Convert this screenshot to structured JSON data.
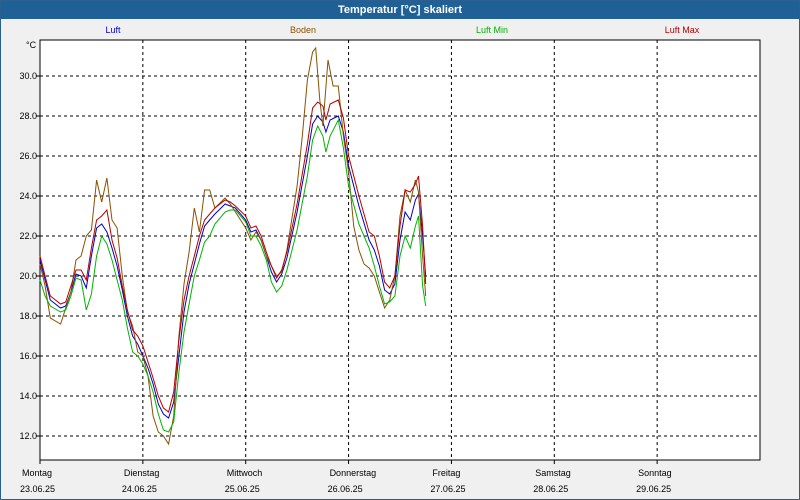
{
  "window": {
    "title": "Temperatur [°C] skaliert"
  },
  "chart_data": {
    "type": "line",
    "title": "Temperatur [°C] skaliert",
    "ylabel": "°C",
    "xlabel": "",
    "ylim": [
      10.8,
      31.8
    ],
    "yticks": [
      "12.0",
      "14.0",
      "16.0",
      "18.0",
      "20.0",
      "22.0",
      "24.0",
      "26.0",
      "28.0",
      "30.0"
    ],
    "xlim": [
      0,
      7
    ],
    "x_days": [
      {
        "weekday": "Montag",
        "date": "23.06.25"
      },
      {
        "weekday": "Dienstag",
        "date": "24.06.25"
      },
      {
        "weekday": "Mittwoch",
        "date": "25.06.25"
      },
      {
        "weekday": "Donnerstag",
        "date": "26.06.25"
      },
      {
        "weekday": "Freitag",
        "date": "27.06.25"
      },
      {
        "weekday": "Samstag",
        "date": "28.06.25"
      },
      {
        "weekday": "Sonntag",
        "date": "29.06.25"
      }
    ],
    "grid": true,
    "legend_position": "top",
    "series": [
      {
        "name": "Luft",
        "color": "#0000c8",
        "points": [
          [
            0.0,
            20.8
          ],
          [
            0.05,
            19.8
          ],
          [
            0.1,
            18.8
          ],
          [
            0.2,
            18.4
          ],
          [
            0.25,
            18.5
          ],
          [
            0.3,
            19.2
          ],
          [
            0.35,
            20.1
          ],
          [
            0.4,
            20.0
          ],
          [
            0.45,
            19.4
          ],
          [
            0.5,
            21.0
          ],
          [
            0.55,
            22.4
          ],
          [
            0.6,
            22.6
          ],
          [
            0.65,
            22.2
          ],
          [
            0.7,
            21.4
          ],
          [
            0.75,
            20.5
          ],
          [
            0.8,
            19.3
          ],
          [
            0.85,
            18.0
          ],
          [
            0.9,
            17.0
          ],
          [
            0.95,
            16.6
          ],
          [
            1.0,
            16.0
          ],
          [
            1.05,
            15.4
          ],
          [
            1.1,
            14.6
          ],
          [
            1.15,
            13.6
          ],
          [
            1.2,
            13.1
          ],
          [
            1.25,
            12.9
          ],
          [
            1.3,
            13.7
          ],
          [
            1.35,
            16.0
          ],
          [
            1.4,
            18.2
          ],
          [
            1.45,
            19.6
          ],
          [
            1.5,
            20.6
          ],
          [
            1.55,
            21.6
          ],
          [
            1.6,
            22.5
          ],
          [
            1.65,
            22.8
          ],
          [
            1.7,
            23.1
          ],
          [
            1.8,
            23.6
          ],
          [
            1.85,
            23.5
          ],
          [
            1.9,
            23.4
          ],
          [
            2.0,
            22.8
          ],
          [
            2.05,
            22.2
          ],
          [
            2.1,
            22.3
          ],
          [
            2.15,
            21.8
          ],
          [
            2.2,
            21.0
          ],
          [
            2.25,
            20.2
          ],
          [
            2.3,
            19.7
          ],
          [
            2.35,
            20.1
          ],
          [
            2.4,
            20.9
          ],
          [
            2.5,
            23.2
          ],
          [
            2.6,
            26.0
          ],
          [
            2.65,
            27.6
          ],
          [
            2.7,
            28.0
          ],
          [
            2.75,
            27.7
          ],
          [
            2.78,
            27.2
          ],
          [
            2.82,
            27.8
          ],
          [
            2.9,
            28.0
          ],
          [
            2.95,
            27.2
          ],
          [
            3.0,
            25.5
          ],
          [
            3.1,
            23.5
          ],
          [
            3.2,
            21.8
          ],
          [
            3.25,
            21.3
          ],
          [
            3.3,
            20.5
          ],
          [
            3.35,
            19.3
          ],
          [
            3.4,
            19.1
          ],
          [
            3.45,
            19.6
          ],
          [
            3.5,
            21.8
          ],
          [
            3.55,
            23.2
          ],
          [
            3.6,
            22.8
          ],
          [
            3.65,
            23.8
          ],
          [
            3.68,
            24.1
          ],
          [
            3.72,
            22.0
          ],
          [
            3.75,
            20.0
          ]
        ]
      },
      {
        "name": "Boden",
        "color": "#8c5000",
        "points": [
          [
            0.0,
            20.6
          ],
          [
            0.05,
            19.5
          ],
          [
            0.1,
            17.9
          ],
          [
            0.2,
            17.6
          ],
          [
            0.3,
            19.2
          ],
          [
            0.35,
            20.8
          ],
          [
            0.4,
            21.0
          ],
          [
            0.45,
            22.0
          ],
          [
            0.5,
            22.3
          ],
          [
            0.55,
            24.8
          ],
          [
            0.6,
            23.7
          ],
          [
            0.65,
            24.9
          ],
          [
            0.7,
            22.8
          ],
          [
            0.75,
            22.4
          ],
          [
            0.8,
            20.0
          ],
          [
            0.85,
            18.2
          ],
          [
            0.9,
            17.5
          ],
          [
            0.95,
            16.2
          ],
          [
            1.0,
            16.0
          ],
          [
            1.05,
            15.0
          ],
          [
            1.1,
            13.0
          ],
          [
            1.15,
            12.2
          ],
          [
            1.2,
            12.0
          ],
          [
            1.25,
            11.6
          ],
          [
            1.3,
            13.0
          ],
          [
            1.35,
            17.0
          ],
          [
            1.4,
            19.6
          ],
          [
            1.45,
            21.2
          ],
          [
            1.5,
            23.4
          ],
          [
            1.55,
            22.2
          ],
          [
            1.6,
            24.3
          ],
          [
            1.65,
            24.3
          ],
          [
            1.7,
            23.4
          ],
          [
            1.8,
            23.9
          ],
          [
            1.85,
            23.6
          ],
          [
            1.9,
            23.2
          ],
          [
            2.0,
            22.4
          ],
          [
            2.05,
            21.8
          ],
          [
            2.1,
            22.2
          ],
          [
            2.15,
            21.8
          ],
          [
            2.2,
            21.0
          ],
          [
            2.25,
            20.5
          ],
          [
            2.3,
            20.0
          ],
          [
            2.35,
            20.2
          ],
          [
            2.4,
            21.3
          ],
          [
            2.5,
            24.5
          ],
          [
            2.55,
            27.0
          ],
          [
            2.6,
            29.8
          ],
          [
            2.65,
            31.2
          ],
          [
            2.68,
            31.4
          ],
          [
            2.72,
            28.8
          ],
          [
            2.75,
            27.5
          ],
          [
            2.8,
            30.8
          ],
          [
            2.85,
            29.5
          ],
          [
            2.9,
            29.5
          ],
          [
            2.95,
            27.0
          ],
          [
            3.0,
            25.2
          ],
          [
            3.05,
            22.5
          ],
          [
            3.1,
            21.3
          ],
          [
            3.15,
            20.6
          ],
          [
            3.2,
            20.4
          ],
          [
            3.25,
            20.0
          ],
          [
            3.3,
            19.2
          ],
          [
            3.35,
            18.4
          ],
          [
            3.4,
            18.8
          ],
          [
            3.45,
            20.0
          ],
          [
            3.5,
            23.0
          ],
          [
            3.55,
            24.3
          ],
          [
            3.6,
            23.7
          ],
          [
            3.65,
            24.8
          ],
          [
            3.68,
            24.2
          ],
          [
            3.72,
            21.0
          ],
          [
            3.75,
            19.0
          ]
        ]
      },
      {
        "name": "Luft Min",
        "color": "#00b400",
        "points": [
          [
            0.0,
            19.8
          ],
          [
            0.05,
            19.0
          ],
          [
            0.1,
            18.5
          ],
          [
            0.2,
            18.2
          ],
          [
            0.25,
            18.3
          ],
          [
            0.3,
            19.0
          ],
          [
            0.35,
            19.9
          ],
          [
            0.4,
            19.8
          ],
          [
            0.45,
            18.3
          ],
          [
            0.5,
            19.1
          ],
          [
            0.55,
            21.0
          ],
          [
            0.6,
            22.0
          ],
          [
            0.65,
            21.6
          ],
          [
            0.7,
            20.8
          ],
          [
            0.75,
            19.8
          ],
          [
            0.8,
            18.8
          ],
          [
            0.85,
            17.4
          ],
          [
            0.9,
            16.2
          ],
          [
            0.95,
            16.0
          ],
          [
            1.0,
            15.6
          ],
          [
            1.05,
            15.0
          ],
          [
            1.1,
            14.2
          ],
          [
            1.15,
            13.1
          ],
          [
            1.2,
            12.3
          ],
          [
            1.25,
            12.2
          ],
          [
            1.3,
            12.7
          ],
          [
            1.35,
            15.2
          ],
          [
            1.4,
            17.2
          ],
          [
            1.45,
            18.6
          ],
          [
            1.5,
            20.0
          ],
          [
            1.55,
            20.8
          ],
          [
            1.6,
            21.7
          ],
          [
            1.65,
            22.0
          ],
          [
            1.7,
            22.6
          ],
          [
            1.8,
            23.2
          ],
          [
            1.85,
            23.3
          ],
          [
            1.9,
            23.3
          ],
          [
            2.0,
            22.7
          ],
          [
            2.05,
            22.0
          ],
          [
            2.1,
            22.0
          ],
          [
            2.15,
            21.5
          ],
          [
            2.2,
            20.8
          ],
          [
            2.25,
            19.7
          ],
          [
            2.3,
            19.2
          ],
          [
            2.35,
            19.5
          ],
          [
            2.4,
            20.3
          ],
          [
            2.5,
            22.3
          ],
          [
            2.6,
            25.0
          ],
          [
            2.65,
            26.8
          ],
          [
            2.7,
            27.5
          ],
          [
            2.75,
            27.0
          ],
          [
            2.78,
            26.2
          ],
          [
            2.82,
            27.0
          ],
          [
            2.9,
            27.8
          ],
          [
            2.95,
            26.4
          ],
          [
            3.0,
            24.5
          ],
          [
            3.1,
            22.6
          ],
          [
            3.2,
            21.4
          ],
          [
            3.25,
            20.5
          ],
          [
            3.3,
            19.5
          ],
          [
            3.35,
            18.6
          ],
          [
            3.4,
            18.7
          ],
          [
            3.45,
            19.0
          ],
          [
            3.5,
            21.0
          ],
          [
            3.55,
            22.0
          ],
          [
            3.6,
            21.4
          ],
          [
            3.65,
            22.5
          ],
          [
            3.68,
            23.0
          ],
          [
            3.72,
            19.5
          ],
          [
            3.75,
            18.5
          ]
        ]
      },
      {
        "name": "Luft Max",
        "color": "#b40000",
        "points": [
          [
            0.0,
            21.0
          ],
          [
            0.05,
            20.0
          ],
          [
            0.1,
            19.0
          ],
          [
            0.2,
            18.6
          ],
          [
            0.25,
            18.7
          ],
          [
            0.3,
            19.5
          ],
          [
            0.35,
            20.3
          ],
          [
            0.4,
            20.3
          ],
          [
            0.45,
            19.8
          ],
          [
            0.5,
            21.4
          ],
          [
            0.55,
            22.8
          ],
          [
            0.6,
            23.0
          ],
          [
            0.65,
            23.3
          ],
          [
            0.7,
            21.8
          ],
          [
            0.75,
            20.9
          ],
          [
            0.8,
            19.5
          ],
          [
            0.85,
            18.3
          ],
          [
            0.9,
            17.3
          ],
          [
            0.95,
            17.0
          ],
          [
            1.0,
            16.5
          ],
          [
            1.05,
            15.7
          ],
          [
            1.1,
            14.9
          ],
          [
            1.15,
            14.0
          ],
          [
            1.2,
            13.4
          ],
          [
            1.25,
            13.2
          ],
          [
            1.3,
            14.2
          ],
          [
            1.35,
            16.8
          ],
          [
            1.4,
            18.8
          ],
          [
            1.45,
            20.0
          ],
          [
            1.5,
            21.0
          ],
          [
            1.55,
            22.0
          ],
          [
            1.6,
            22.8
          ],
          [
            1.65,
            23.1
          ],
          [
            1.7,
            23.4
          ],
          [
            1.8,
            23.8
          ],
          [
            1.85,
            23.7
          ],
          [
            1.9,
            23.5
          ],
          [
            2.0,
            23.0
          ],
          [
            2.05,
            22.4
          ],
          [
            2.1,
            22.5
          ],
          [
            2.15,
            22.0
          ],
          [
            2.2,
            21.2
          ],
          [
            2.25,
            20.5
          ],
          [
            2.3,
            19.9
          ],
          [
            2.35,
            20.3
          ],
          [
            2.4,
            21.2
          ],
          [
            2.5,
            23.6
          ],
          [
            2.6,
            26.6
          ],
          [
            2.65,
            28.4
          ],
          [
            2.7,
            28.7
          ],
          [
            2.75,
            28.5
          ],
          [
            2.78,
            27.8
          ],
          [
            2.82,
            28.6
          ],
          [
            2.9,
            28.8
          ],
          [
            2.95,
            27.9
          ],
          [
            3.0,
            26.0
          ],
          [
            3.1,
            24.0
          ],
          [
            3.2,
            22.2
          ],
          [
            3.25,
            22.0
          ],
          [
            3.3,
            21.0
          ],
          [
            3.35,
            19.7
          ],
          [
            3.4,
            19.4
          ],
          [
            3.45,
            20.0
          ],
          [
            3.5,
            22.5
          ],
          [
            3.55,
            24.3
          ],
          [
            3.6,
            24.2
          ],
          [
            3.65,
            24.6
          ],
          [
            3.68,
            25.0
          ],
          [
            3.72,
            22.5
          ],
          [
            3.75,
            19.6
          ]
        ]
      }
    ]
  }
}
